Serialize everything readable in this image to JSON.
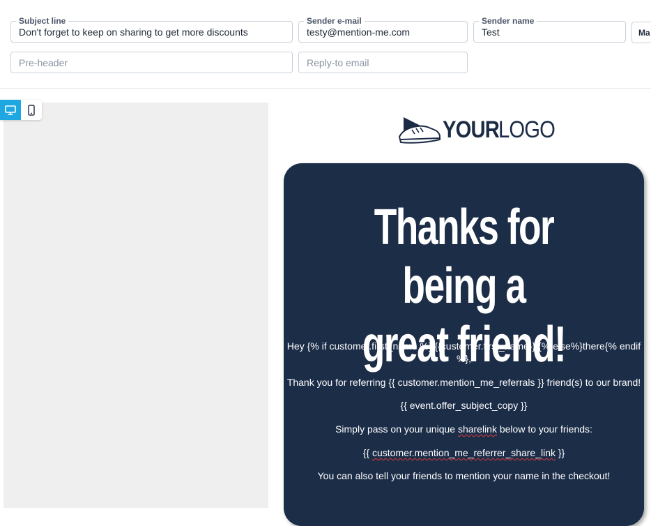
{
  "form": {
    "subject": {
      "label": "Subject line",
      "value": "Don't forget to keep on sharing to get more discounts"
    },
    "sender_email": {
      "label": "Sender e-mail",
      "value": "testy@mention-me.com"
    },
    "sender_name": {
      "label": "Sender name",
      "value": "Test"
    },
    "side_button": {
      "label": "Ma"
    },
    "preheader": {
      "placeholder": "Pre-header"
    },
    "reply_to": {
      "placeholder": "Reply-to email"
    }
  },
  "device_toggle": {
    "desktop_icon": "desktop-icon",
    "mobile_icon": "mobile-icon",
    "active": "desktop",
    "active_color": "#1ea7e0"
  },
  "email": {
    "logo": {
      "bold": "YOUR",
      "light": "LOGO"
    },
    "headline": [
      "Thanks for being a",
      "great friend!"
    ],
    "greeting_line1": "Hey {% if customer.first_name %} {{customer.first_name}} {% else%}there{% endif",
    "greeting_line2": "%},",
    "referral_line": "Thank you for referring {{ customer.mention_me_referrals }} friend(s) to our brand!",
    "offer_line": "{{ event.offer_subject_copy }}",
    "share_pre": "Simply pass on your unique ",
    "share_word": "sharelink",
    "share_post": " below to your friends:",
    "link_open": "{{ ",
    "link_word": "customer.mention_me_referrer_share_link",
    "link_close": " }}",
    "checkout_line": "You can also tell your friends to mention your name in the checkout!",
    "card_color": "#1c2d48"
  }
}
